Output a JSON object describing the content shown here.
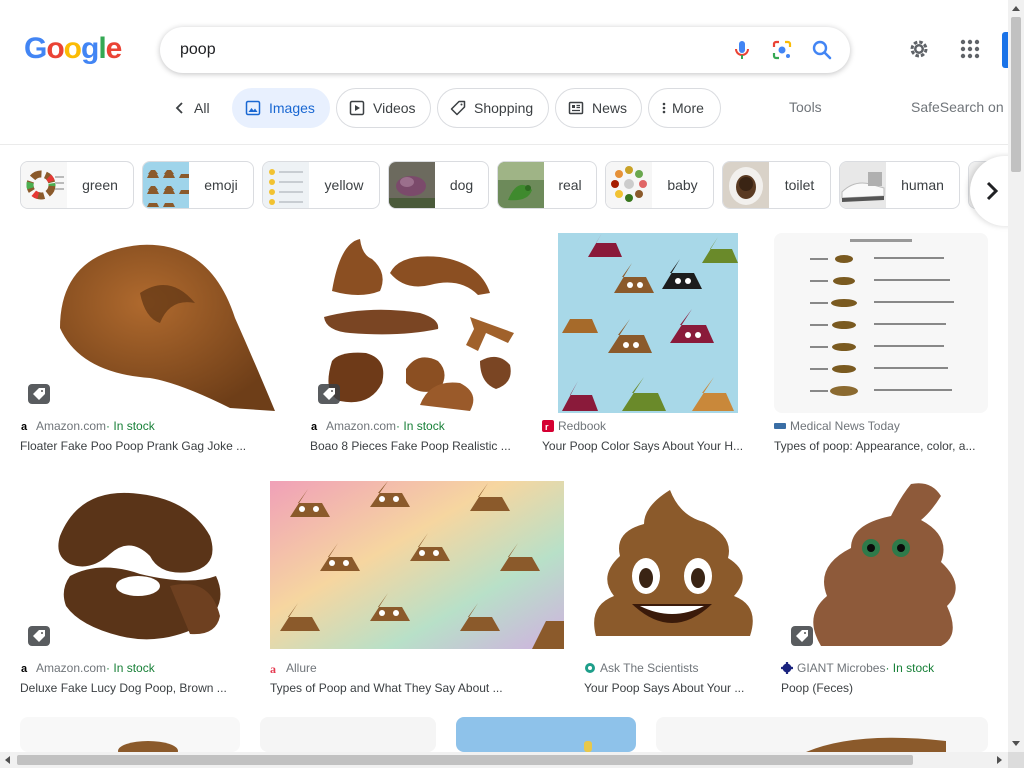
{
  "logo": {
    "letters": [
      "G",
      "o",
      "o",
      "g",
      "l",
      "e"
    ],
    "colors": [
      "#4285f4",
      "#ea4335",
      "#fbbc05",
      "#4285f4",
      "#34a853",
      "#ea4335"
    ]
  },
  "search": {
    "value": "poop"
  },
  "icons": {
    "mic": "mic-icon",
    "lens": "camera-lens-icon",
    "search": "search-icon",
    "settings": "gear-icon",
    "apps": "apps-grid-icon"
  },
  "tabs": [
    {
      "label": "All"
    },
    {
      "label": "Images"
    },
    {
      "label": "Videos"
    },
    {
      "label": "Shopping"
    },
    {
      "label": "News"
    },
    {
      "label": "More"
    }
  ],
  "tools_label": "Tools",
  "safesearch_label": "SafeSearch on",
  "chips": [
    {
      "label": "green"
    },
    {
      "label": "emoji"
    },
    {
      "label": "yellow"
    },
    {
      "label": "dog"
    },
    {
      "label": "real"
    },
    {
      "label": "baby"
    },
    {
      "label": "toilet"
    },
    {
      "label": "human"
    }
  ],
  "results": [
    {
      "source": "Amazon.com",
      "stock": " · In stock",
      "title": "Floater Fake Poo Poop Prank Gag Joke ..."
    },
    {
      "source": "Amazon.com",
      "stock": " · In stock",
      "title": "Boao 8 Pieces Fake Poop Realistic ..."
    },
    {
      "source": "Redbook",
      "stock": "",
      "title": "Your Poop Color Says About Your H..."
    },
    {
      "source": "Medical News Today",
      "stock": "",
      "title": "Types of poop: Appearance, color, a..."
    },
    {
      "source": "Amazon.com",
      "stock": " · In stock",
      "title": "Deluxe Fake Lucy Dog Poop, Brown ..."
    },
    {
      "source": "Allure",
      "stock": "",
      "title": "Types of Poop and What They Say About ..."
    },
    {
      "source": "Ask The Scientists",
      "stock": "",
      "title": "Your Poop Says About Your ..."
    },
    {
      "source": "GIANT Microbes",
      "stock": " · In stock",
      "title": "Poop (Feces)"
    }
  ],
  "colors": {
    "accent": "#1a73e8",
    "stock_green": "#188038",
    "poop_brown": "#8b5a2b"
  }
}
